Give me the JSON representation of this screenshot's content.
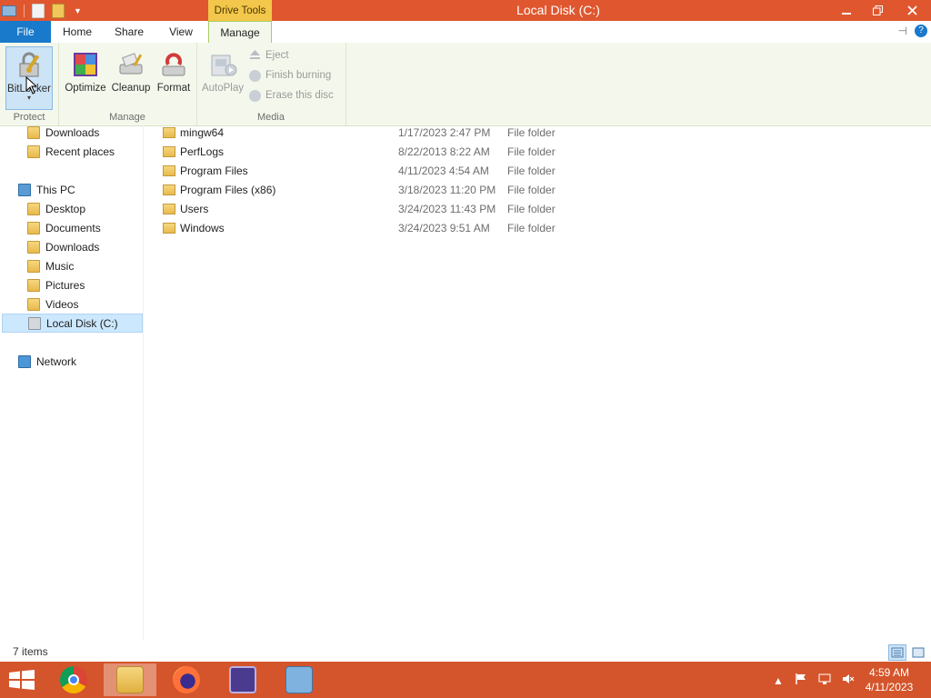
{
  "titlebar": {
    "contextual_tab": "Drive Tools",
    "window_title": "Local Disk (C:)"
  },
  "ribbon_tabs": {
    "file": "File",
    "home": "Home",
    "share": "Share",
    "view": "View",
    "manage": "Manage"
  },
  "ribbon": {
    "protect": {
      "label": "Protect",
      "bitlocker": "BitLocker"
    },
    "manage": {
      "label": "Manage",
      "optimize": "Optimize",
      "cleanup": "Cleanup",
      "format": "Format"
    },
    "media": {
      "label": "Media",
      "autoplay": "AutoPlay",
      "eject": "Eject",
      "finish_burning": "Finish burning",
      "erase_disc": "Erase this disc"
    }
  },
  "nav": {
    "downloads_fav": "Downloads",
    "recent_places": "Recent places",
    "this_pc": "This PC",
    "desktop": "Desktop",
    "documents": "Documents",
    "downloads": "Downloads",
    "music": "Music",
    "pictures": "Pictures",
    "videos": "Videos",
    "local_disk": "Local Disk (C:)",
    "network": "Network"
  },
  "files": [
    {
      "name": "mingw64",
      "date": "1/17/2023 2:47 PM",
      "type": "File folder"
    },
    {
      "name": "PerfLogs",
      "date": "8/22/2013 8:22 AM",
      "type": "File folder"
    },
    {
      "name": "Program Files",
      "date": "4/11/2023 4:54 AM",
      "type": "File folder"
    },
    {
      "name": "Program Files (x86)",
      "date": "3/18/2023 11:20 PM",
      "type": "File folder"
    },
    {
      "name": "Users",
      "date": "3/24/2023 11:43 PM",
      "type": "File folder"
    },
    {
      "name": "Windows",
      "date": "3/24/2023 9:51 AM",
      "type": "File folder"
    }
  ],
  "status": {
    "item_count": "7 items"
  },
  "taskbar": {
    "time": "4:59 AM",
    "date": "4/11/2023",
    "apps": [
      "chrome-icon",
      "file-explorer-icon",
      "firefox-icon",
      "vscode-icon",
      "remote-desktop-icon"
    ]
  },
  "colors": {
    "titlebar": "#e0572f",
    "contextual_tab": "#f3c74b",
    "file_tab": "#1979ca",
    "ribbon_bg": "#f4f8ec",
    "taskbar": "#d4552b",
    "selection": "#cce8ff"
  }
}
